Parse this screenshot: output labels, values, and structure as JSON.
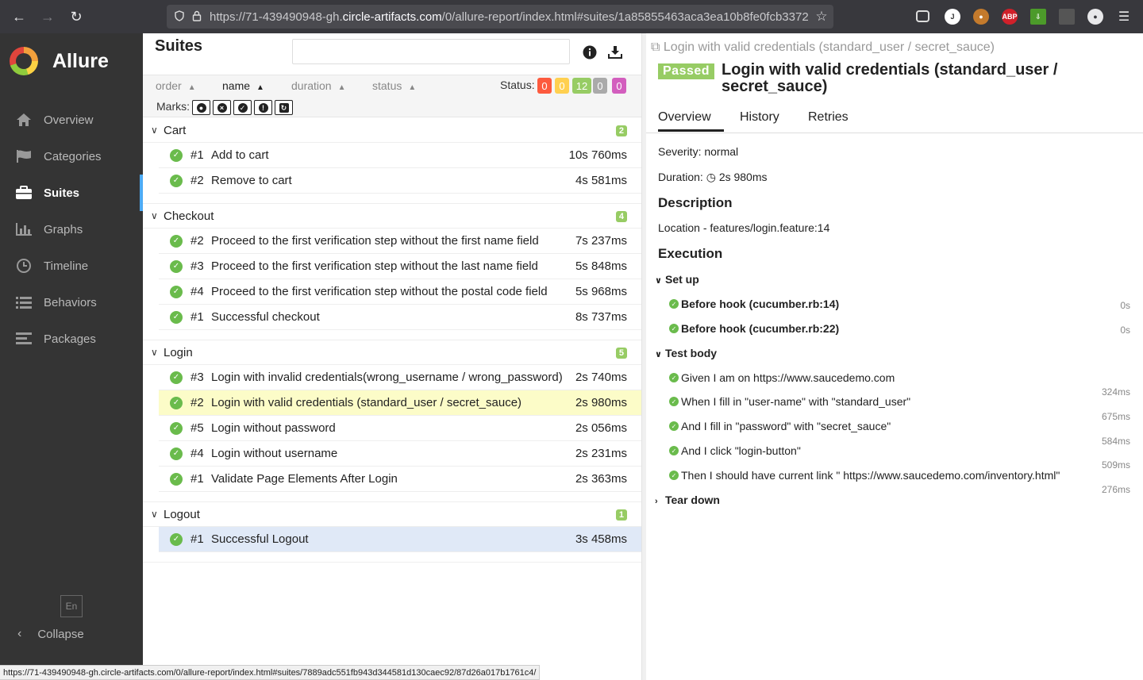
{
  "browser": {
    "url_prefix": "https://71-439490948-gh.",
    "url_domain": "circle-artifacts.com",
    "url_rest": "/0/allure-report/index.html#suites/1a85855463aca3ea10b8fe0fcb3372",
    "status_url": "https://71-439490948-gh.circle-artifacts.com/0/allure-report/index.html#suites/7889adc551fb943d344581d130caec92/87d26a017b1761c4/"
  },
  "sidebar": {
    "brand": "Allure",
    "items": [
      {
        "label": "Overview",
        "icon": "home-icon"
      },
      {
        "label": "Categories",
        "icon": "flag-icon"
      },
      {
        "label": "Suites",
        "icon": "briefcase-icon",
        "active": true
      },
      {
        "label": "Graphs",
        "icon": "bar-chart-icon"
      },
      {
        "label": "Timeline",
        "icon": "clock-icon"
      },
      {
        "label": "Behaviors",
        "icon": "list-icon"
      },
      {
        "label": "Packages",
        "icon": "align-left-icon"
      }
    ],
    "lang": "En",
    "collapse": "Collapse"
  },
  "suites": {
    "title": "Suites",
    "search_placeholder": "",
    "sort": {
      "order": "order",
      "name": "name",
      "duration": "duration",
      "status": "status"
    },
    "status_label": "Status:",
    "status_counts": [
      {
        "value": "0",
        "color": "#fd5a3e"
      },
      {
        "value": "0",
        "color": "#ffd050"
      },
      {
        "value": "12",
        "color": "#97cc64"
      },
      {
        "value": "0",
        "color": "#aaaaaa"
      },
      {
        "value": "0",
        "color": "#d35ebe"
      }
    ],
    "marks_label": "Marks:",
    "groups": [
      {
        "name": "Cart",
        "count": "2",
        "tests": [
          {
            "num": "#1",
            "name": "Add to cart",
            "duration": "10s 760ms"
          },
          {
            "num": "#2",
            "name": "Remove to cart",
            "duration": "4s 581ms"
          }
        ]
      },
      {
        "name": "Checkout",
        "count": "4",
        "tests": [
          {
            "num": "#2",
            "name": "Proceed to the first verification step without the first name field",
            "duration": "7s 237ms"
          },
          {
            "num": "#3",
            "name": "Proceed to the first verification step without the last name field",
            "duration": "5s 848ms"
          },
          {
            "num": "#4",
            "name": "Proceed to the first verification step without the postal code field",
            "duration": "5s 968ms"
          },
          {
            "num": "#1",
            "name": "Successful checkout",
            "duration": "8s 737ms"
          }
        ]
      },
      {
        "name": "Login",
        "count": "5",
        "tests": [
          {
            "num": "#3",
            "name": "Login with invalid credentials(wrong_username / wrong_password)",
            "duration": "2s 740ms"
          },
          {
            "num": "#2",
            "name": "Login with valid credentials (standard_user / secret_sauce)",
            "duration": "2s 980ms",
            "state": "hl"
          },
          {
            "num": "#5",
            "name": "Login without password",
            "duration": "2s 056ms"
          },
          {
            "num": "#4",
            "name": "Login without username",
            "duration": "2s 231ms"
          },
          {
            "num": "#1",
            "name": "Validate Page Elements After Login",
            "duration": "2s 363ms"
          }
        ]
      },
      {
        "name": "Logout",
        "count": "1",
        "tests": [
          {
            "num": "#1",
            "name": "Successful Logout",
            "duration": "3s 458ms",
            "state": "sel"
          }
        ]
      }
    ]
  },
  "detail": {
    "crumb": "Login with valid credentials (standard_user / secret_sauce)",
    "status": "Passed",
    "title": "Login with valid credentials (standard_user / secret_sauce)",
    "tabs": [
      "Overview",
      "History",
      "Retries"
    ],
    "severity": "Severity: normal",
    "duration_label": "Duration:",
    "duration": "2s 980ms",
    "description_heading": "Description",
    "location": "Location - features/login.feature:14",
    "execution_heading": "Execution",
    "setup_label": "Set up",
    "setup_steps": [
      {
        "name": "Before hook (cucumber.rb:14)",
        "duration": "0s"
      },
      {
        "name": "Before hook (cucumber.rb:22)",
        "duration": "0s"
      }
    ],
    "body_label": "Test body",
    "body_steps": [
      {
        "name": "Given I am on https://www.saucedemo.com",
        "duration": "324ms"
      },
      {
        "name": "When I fill in \"user-name\" with \"standard_user\"",
        "duration": "675ms"
      },
      {
        "name": "And I fill in \"password\" with \"secret_sauce\"",
        "duration": "584ms"
      },
      {
        "name": "And I click \"login-button\"",
        "duration": "509ms"
      },
      {
        "name": "Then I should have current link \" https://www.saucedemo.com/inventory.html\"",
        "duration": "276ms"
      }
    ],
    "teardown_label": "Tear down"
  }
}
